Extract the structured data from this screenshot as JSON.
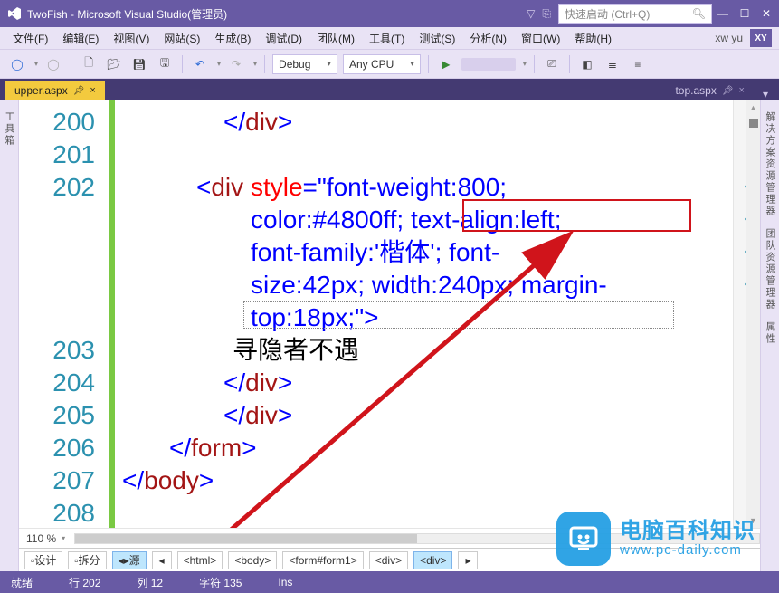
{
  "window": {
    "title": "TwoFish - Microsoft Visual Studio(管理员)"
  },
  "quick_launch": {
    "placeholder": "快速启动 (Ctrl+Q)"
  },
  "menu": {
    "file": "文件(F)",
    "edit": "编辑(E)",
    "view": "视图(V)",
    "website": "网站(S)",
    "build": "生成(B)",
    "debug": "调试(D)",
    "team": "团队(M)",
    "tools": "工具(T)",
    "test": "测试(S)",
    "analyze": "分析(N)",
    "window": "窗口(W)",
    "help": "帮助(H)",
    "user": "xw yu",
    "avatar": "XY"
  },
  "toolbar": {
    "config": "Debug",
    "platform": "Any CPU"
  },
  "tabs": {
    "active": {
      "label": "upper.aspx"
    },
    "inactive": {
      "label": "top.aspx"
    }
  },
  "sidebar_left": {
    "toolbox": "工具箱"
  },
  "sidebar_right": {
    "t1": "解决方案资源管理器",
    "t2": "团队资源管理器",
    "t3": "属性"
  },
  "editor": {
    "zoom": "110 %",
    "lines": {
      "l200": "200",
      "l201": "201",
      "l202": "202",
      "l203": "203",
      "l204": "204",
      "l205": "205",
      "l206": "206",
      "l207": "207",
      "l208": "208"
    },
    "c200_close_div": "</div>",
    "c202_open": "<div ",
    "c202_attr": "style=",
    "c202_q": "\"",
    "c202_v1": "font-weight:800;",
    "c202_v2a": "color:#4800ff; ",
    "c202_v2b": "text-align:left;",
    "c202_v3": "font-family:'楷体'; font-size:42px; width:240px; margin-top:18px;",
    "c202_v3_l1": "font-family:'楷体'; font-",
    "c202_v3_l2": "size:42px; width:240px; margin-",
    "c202_v3_l3": "top:18px;",
    "c202_close": ">",
    "c203_text": "寻隐者不遇",
    "c204": "</div>",
    "c205": "</div>",
    "c206": "</form>",
    "c207": "</body>",
    "c208": ""
  },
  "bottom_tabs": {
    "design": "设计",
    "split": "拆分",
    "source": "源",
    "path": [
      "<html>",
      "<body>",
      "<form#form1>",
      "<div>",
      "<div>"
    ]
  },
  "status": {
    "ready": "就绪",
    "line": "行 202",
    "col": "列 12",
    "char": "字符 135",
    "ins": "Ins"
  },
  "watermark": {
    "l1": "电脑百科知识",
    "l2": "www.pc-daily.com"
  },
  "chart_data": null
}
